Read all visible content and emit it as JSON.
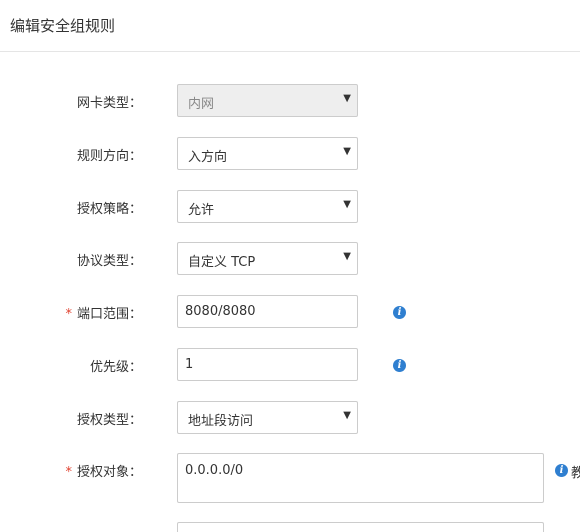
{
  "dialog": {
    "title": "编辑安全组规则"
  },
  "form": {
    "nic_type": {
      "label": "网卡类型：",
      "value": "内网",
      "disabled": true
    },
    "direction": {
      "label": "规则方向：",
      "value": "入方向"
    },
    "policy": {
      "label": "授权策略：",
      "value": "允许"
    },
    "protocol": {
      "label": "协议类型：",
      "value": "自定义 TCP"
    },
    "port_range": {
      "required_mark": "*",
      "label": "端口范围：",
      "value": "8080/8080"
    },
    "priority": {
      "label": "优先级：",
      "value": "1"
    },
    "auth_type": {
      "label": "授权类型：",
      "value": "地址段访问"
    },
    "auth_object": {
      "required_mark": "*",
      "label": "授权对象：",
      "value": "0.0.0.0/0",
      "help_text": "教"
    }
  },
  "icons": {
    "info": "info-icon",
    "dropdown": "caret-down-icon",
    "info_glyph": "i",
    "caret_glyph": "▼"
  }
}
